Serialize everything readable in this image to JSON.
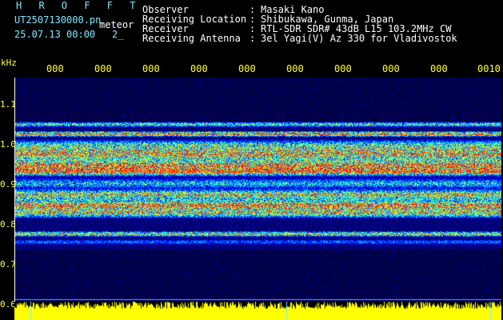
{
  "header": {
    "title": "H R O F F T",
    "filename": "UT2507130000.pn",
    "subtitle": "meteor",
    "datetime": "25.07.13 00:00",
    "page": "2_"
  },
  "meta": [
    {
      "label": "Observer",
      "sep": ":",
      "value": "Masaki Kano"
    },
    {
      "label": "Receiving Location",
      "sep": ":",
      "value": "Shibukawa, Gunma, Japan"
    },
    {
      "label": "Receiver",
      "sep": ":",
      "value": "RTL-SDR SDR# 43dB L15 103.2MHz CW"
    },
    {
      "label": "Receiving Antenna",
      "sep": ":",
      "value": "3el Yagi(V) Az 330 for Vladivostok"
    }
  ],
  "axis": {
    "y_unit": "kHz",
    "y_ticks": [
      "1.1",
      "1.0",
      "0.9",
      "0.8",
      "0.7",
      "0.6"
    ],
    "x_ticks": [
      "000",
      "000",
      "000",
      "000",
      "000",
      "000",
      "000",
      "000",
      "000",
      "0010"
    ]
  },
  "colors": {
    "header_title": "#7fe7ff",
    "text": "#ffffff",
    "axis_labels": "#ffff33",
    "power_bar": "#ffff00",
    "background": "#000000"
  }
}
